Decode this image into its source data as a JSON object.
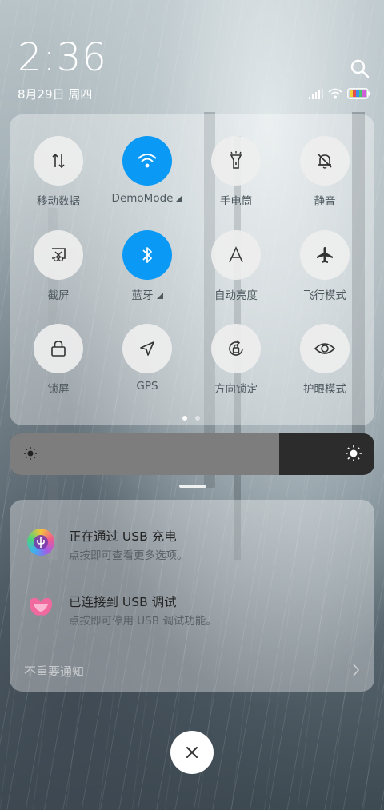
{
  "status": {
    "time": "2:36",
    "date": "8月29日 周四",
    "icons": [
      "signal-icon",
      "wifi-icon",
      "battery-icon"
    ]
  },
  "search": {
    "icon": "search-icon"
  },
  "quick_settings": {
    "tiles": [
      {
        "label": "移动数据",
        "icon": "mobile-data-icon",
        "active": false
      },
      {
        "label": "DemoMode",
        "icon": "wifi-icon",
        "active": true,
        "expandable": true
      },
      {
        "label": "手电筒",
        "icon": "flashlight-icon",
        "active": false
      },
      {
        "label": "静音",
        "icon": "mute-bell-icon",
        "active": false
      },
      {
        "label": "截屏",
        "icon": "screenshot-icon",
        "active": false
      },
      {
        "label": "蓝牙",
        "icon": "bluetooth-icon",
        "active": true,
        "expandable": true
      },
      {
        "label": "自动亮度",
        "icon": "auto-brightness-icon",
        "active": false
      },
      {
        "label": "飞行模式",
        "icon": "airplane-icon",
        "active": false
      },
      {
        "label": "锁屏",
        "icon": "lock-icon",
        "active": false
      },
      {
        "label": "GPS",
        "icon": "gps-icon",
        "active": false
      },
      {
        "label": "方向锁定",
        "icon": "rotation-lock-icon",
        "active": false
      },
      {
        "label": "护眼模式",
        "icon": "eye-icon",
        "active": false
      }
    ],
    "page_count": 2,
    "current_page": 1
  },
  "brightness": {
    "level_fraction": 0.74
  },
  "notifications": {
    "items": [
      {
        "title": "正在通过 USB 充电",
        "subtitle": "点按即可查看更多选项。",
        "icon": "usb-charging-icon"
      },
      {
        "title": "已连接到 USB 调试",
        "subtitle": "点按即可停用 USB 调试功能。",
        "icon": "usb-debug-icon"
      }
    ],
    "unimportant_label": "不重要通知"
  },
  "colors": {
    "accent": "#0a99f5",
    "tile_bg": "#eeeeee"
  }
}
